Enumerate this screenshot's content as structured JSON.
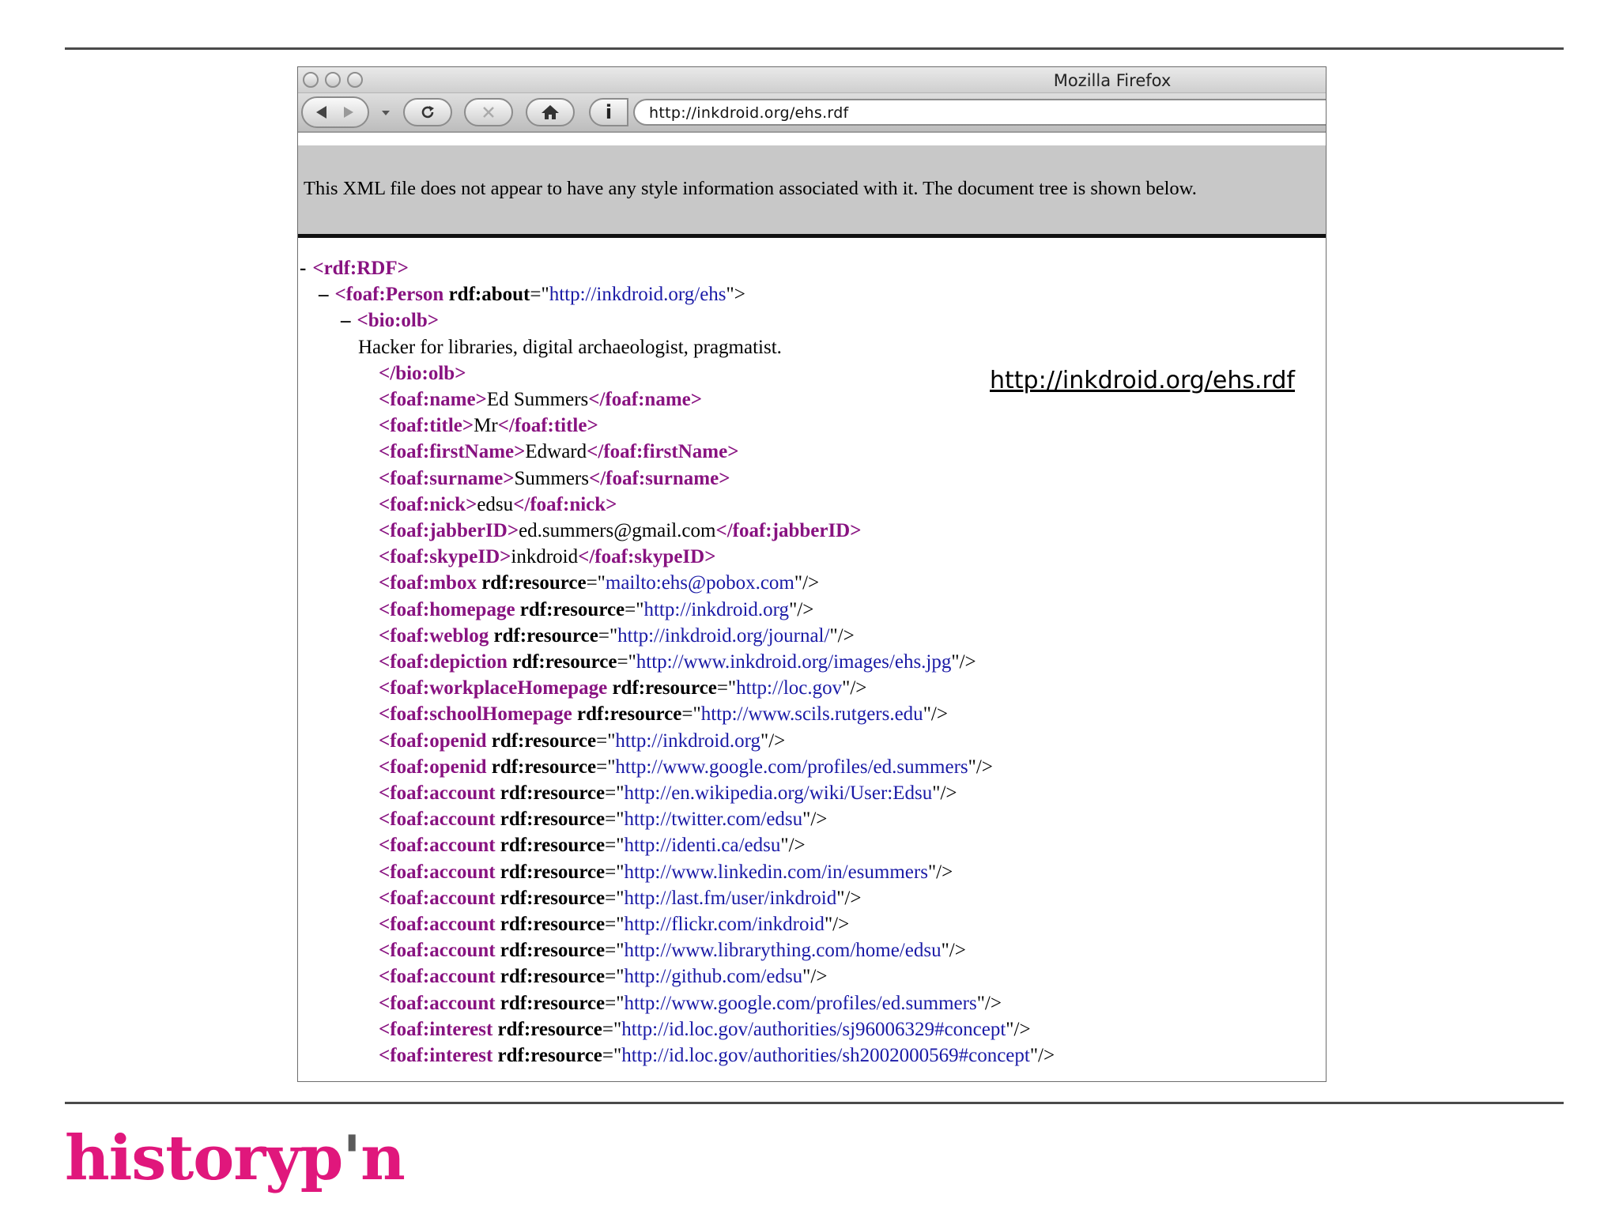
{
  "window_title": "Mozilla Firefox",
  "address_bar": {
    "url": "http://inkdroid.org/ehs.rdf"
  },
  "notice": "This XML file does not appear to have any style information associated with it. The document tree is shown below.",
  "overlay_link": "http://inkdroid.org/ehs.rdf",
  "logo": {
    "part1": "historyp",
    "mark": "'",
    "part2": "n"
  },
  "xml_lines": [
    {
      "minus": "-",
      "t1": "<rdf:RDF>"
    },
    {
      "minus": "–",
      "t1": "<foaf:Person",
      "a1": " rdf:about",
      "eq": "=\"",
      "v1": "http://inkdroid.org/ehs",
      "end": "\">"
    },
    {
      "minus": "–",
      "t1": "<bio:olb>"
    },
    {
      "txt": "Hacker for libraries, digital archaeologist, pragmatist."
    },
    {
      "t1": "</bio:olb>"
    },
    {
      "t1": "<foaf:name>",
      "txt": "Ed Summers",
      "t2": "</foaf:name>"
    },
    {
      "t1": "<foaf:title>",
      "txt": "Mr",
      "t2": "</foaf:title>"
    },
    {
      "t1": "<foaf:firstName>",
      "txt": "Edward",
      "t2": "</foaf:firstName>"
    },
    {
      "t1": "<foaf:surname>",
      "txt": "Summers",
      "t2": "</foaf:surname>"
    },
    {
      "t1": "<foaf:nick>",
      "txt": "edsu",
      "t2": "</foaf:nick>"
    },
    {
      "t1": "<foaf:jabberID>",
      "txt": "ed.summers@gmail.com",
      "t2": "</foaf:jabberID>"
    },
    {
      "t1": "<foaf:skypeID>",
      "txt": "inkdroid",
      "t2": "</foaf:skypeID>"
    },
    {
      "t1": "<foaf:mbox",
      "a1": " rdf:resource",
      "eq": "=\"",
      "v1": "mailto:ehs@pobox.com",
      "end": "\"/>"
    },
    {
      "t1": "<foaf:homepage",
      "a1": " rdf:resource",
      "eq": "=\"",
      "v1": "http://inkdroid.org",
      "end": "\"/>"
    },
    {
      "t1": "<foaf:weblog",
      "a1": " rdf:resource",
      "eq": "=\"",
      "v1": "http://inkdroid.org/journal/",
      "end": "\"/>"
    },
    {
      "t1": "<foaf:depiction",
      "a1": " rdf:resource",
      "eq": "=\"",
      "v1": "http://www.inkdroid.org/images/ehs.jpg",
      "end": "\"/>"
    },
    {
      "t1": "<foaf:workplaceHomepage",
      "a1": " rdf:resource",
      "eq": "=\"",
      "v1": "http://loc.gov",
      "end": "\"/>"
    },
    {
      "t1": "<foaf:schoolHomepage",
      "a1": " rdf:resource",
      "eq": "=\"",
      "v1": "http://www.scils.rutgers.edu",
      "end": "\"/>"
    },
    {
      "t1": "<foaf:openid",
      "a1": " rdf:resource",
      "eq": "=\"",
      "v1": "http://inkdroid.org",
      "end": "\"/>"
    },
    {
      "t1": "<foaf:openid",
      "a1": " rdf:resource",
      "eq": "=\"",
      "v1": "http://www.google.com/profiles/ed.summers",
      "end": "\"/>"
    },
    {
      "t1": "<foaf:account",
      "a1": " rdf:resource",
      "eq": "=\"",
      "v1": "http://en.wikipedia.org/wiki/User:Edsu",
      "end": "\"/>"
    },
    {
      "t1": "<foaf:account",
      "a1": " rdf:resource",
      "eq": "=\"",
      "v1": "http://twitter.com/edsu",
      "end": "\"/>"
    },
    {
      "t1": "<foaf:account",
      "a1": " rdf:resource",
      "eq": "=\"",
      "v1": "http://identi.ca/edsu",
      "end": "\"/>"
    },
    {
      "t1": "<foaf:account",
      "a1": " rdf:resource",
      "eq": "=\"",
      "v1": "http://www.linkedin.com/in/esummers",
      "end": "\"/>"
    },
    {
      "t1": "<foaf:account",
      "a1": " rdf:resource",
      "eq": "=\"",
      "v1": "http://last.fm/user/inkdroid",
      "end": "\"/>"
    },
    {
      "t1": "<foaf:account",
      "a1": " rdf:resource",
      "eq": "=\"",
      "v1": "http://flickr.com/inkdroid",
      "end": "\"/>"
    },
    {
      "t1": "<foaf:account",
      "a1": " rdf:resource",
      "eq": "=\"",
      "v1": "http://www.librarything.com/home/edsu",
      "end": "\"/>"
    },
    {
      "t1": "<foaf:account",
      "a1": " rdf:resource",
      "eq": "=\"",
      "v1": "http://github.com/edsu",
      "end": "\"/>"
    },
    {
      "t1": "<foaf:account",
      "a1": " rdf:resource",
      "eq": "=\"",
      "v1": "http://www.google.com/profiles/ed.summers",
      "end": "\"/>"
    },
    {
      "t1": "<foaf:interest",
      "a1": " rdf:resource",
      "eq": "=\"",
      "v1": "http://id.loc.gov/authorities/sj96006329#concept",
      "end": "\"/>"
    },
    {
      "t1": "<foaf:interest",
      "a1": " rdf:resource",
      "eq": "=\"",
      "v1": "http://id.loc.gov/authorities/sh2002000569#concept",
      "end": "\"/>"
    }
  ]
}
